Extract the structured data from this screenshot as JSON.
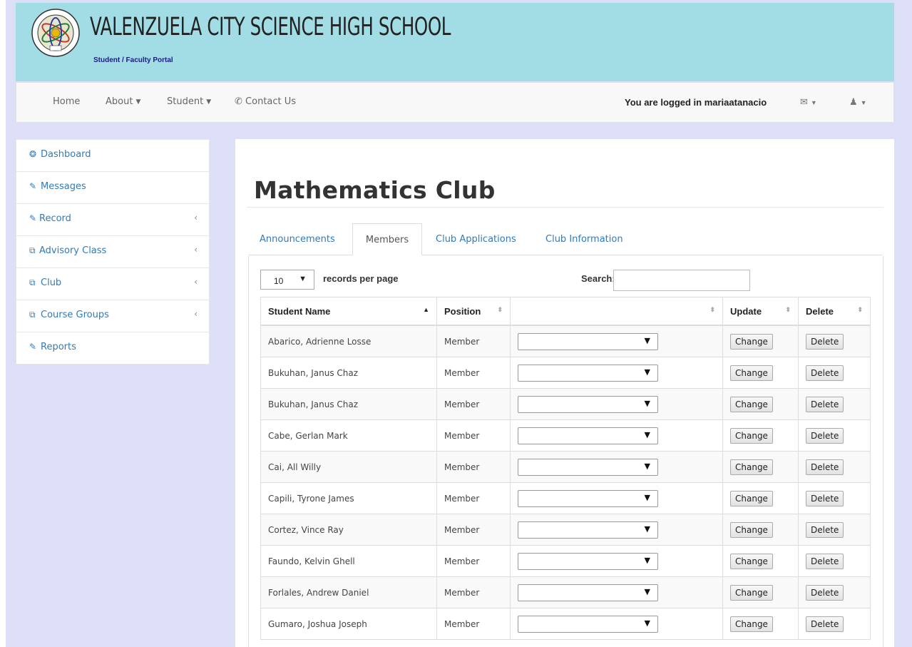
{
  "header": {
    "school_name": "VALENZUELA CITY SCIENCE HIGH SCHOOL",
    "subtitle": "Student / Faculty Portal",
    "logo_icon": "school-seal-icon"
  },
  "navbar": {
    "home": "Home",
    "about": "About",
    "student": "Student",
    "contact": "Contact Us",
    "logged_in": "You are logged in mariaatanacio"
  },
  "sidebar": {
    "items": [
      {
        "label": "Dashboard",
        "icon": "dashboard-icon"
      },
      {
        "label": "Messages",
        "icon": "edit-icon"
      },
      {
        "label": "Record",
        "icon": "edit-icon"
      },
      {
        "label": "Advisory Class",
        "icon": "copy-icon"
      },
      {
        "label": "Club",
        "icon": "copy-icon"
      },
      {
        "label": "Course Groups",
        "icon": "copy-icon"
      },
      {
        "label": "Reports",
        "icon": "edit-icon"
      }
    ]
  },
  "main": {
    "title": "Mathematics Club",
    "tabs": [
      "Announcements",
      "Members",
      "Club Applications",
      "Club Information"
    ],
    "active_tab": "Members",
    "length_value": "10",
    "length_label": "records per page",
    "search_label": "Search:",
    "columns": [
      "Student Name",
      "Position",
      "",
      "Update",
      "Delete"
    ],
    "change_label": "Change",
    "delete_label": "Delete",
    "rows": [
      {
        "name": "Abarico, Adrienne Losse",
        "position": "Member"
      },
      {
        "name": "Bukuhan, Janus Chaz",
        "position": "Member"
      },
      {
        "name": "Bukuhan, Janus Chaz",
        "position": "Member"
      },
      {
        "name": "Cabe, Gerlan Mark",
        "position": "Member"
      },
      {
        "name": "Cai, All Willy",
        "position": "Member"
      },
      {
        "name": "Capili, Tyrone James",
        "position": "Member"
      },
      {
        "name": "Cortez, Vince Ray",
        "position": "Member"
      },
      {
        "name": "Faundo, Kelvin Ghell",
        "position": "Member"
      },
      {
        "name": "Forlales, Andrew Daniel",
        "position": "Member"
      },
      {
        "name": "Gumaro, Joshua Joseph",
        "position": "Member"
      }
    ]
  }
}
